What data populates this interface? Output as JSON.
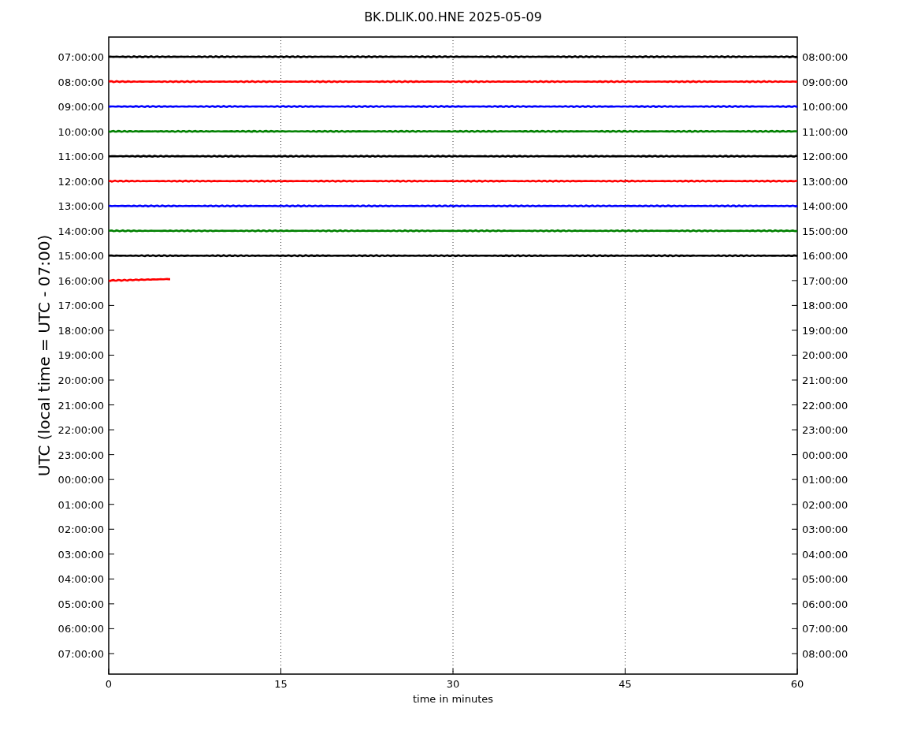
{
  "title": "BK.DLIK.00.HNE 2025-05-09",
  "y_label": "UTC (local time = UTC - 07:00)",
  "x_label": "time in minutes",
  "x_ticks": [
    "0",
    "15",
    "30",
    "45",
    "60"
  ],
  "left_ticks": [
    "07:00:00",
    "08:00:00",
    "09:00:00",
    "10:00:00",
    "11:00:00",
    "12:00:00",
    "13:00:00",
    "14:00:00",
    "15:00:00",
    "16:00:00",
    "17:00:00",
    "18:00:00",
    "19:00:00",
    "20:00:00",
    "21:00:00",
    "22:00:00",
    "23:00:00",
    "00:00:00",
    "01:00:00",
    "02:00:00",
    "03:00:00",
    "04:00:00",
    "05:00:00",
    "06:00:00",
    "07:00:00"
  ],
  "right_ticks": [
    "08:00:00",
    "09:00:00",
    "10:00:00",
    "11:00:00",
    "12:00:00",
    "13:00:00",
    "14:00:00",
    "15:00:00",
    "16:00:00",
    "17:00:00",
    "18:00:00",
    "19:00:00",
    "20:00:00",
    "21:00:00",
    "22:00:00",
    "23:00:00",
    "00:00:00",
    "01:00:00",
    "02:00:00",
    "03:00:00",
    "04:00:00",
    "05:00:00",
    "06:00:00",
    "07:00:00",
    "08:00:00"
  ],
  "traces": [
    {
      "color": "#000000",
      "complete": true
    },
    {
      "color": "#ff0000",
      "complete": true
    },
    {
      "color": "#0000ff",
      "complete": true
    },
    {
      "color": "#008000",
      "complete": true
    },
    {
      "color": "#000000",
      "complete": true
    },
    {
      "color": "#ff0000",
      "complete": true
    },
    {
      "color": "#0000ff",
      "complete": true
    },
    {
      "color": "#008000",
      "complete": true
    },
    {
      "color": "#000000",
      "complete": true
    },
    {
      "color": "#ff0000",
      "complete": false
    }
  ]
}
